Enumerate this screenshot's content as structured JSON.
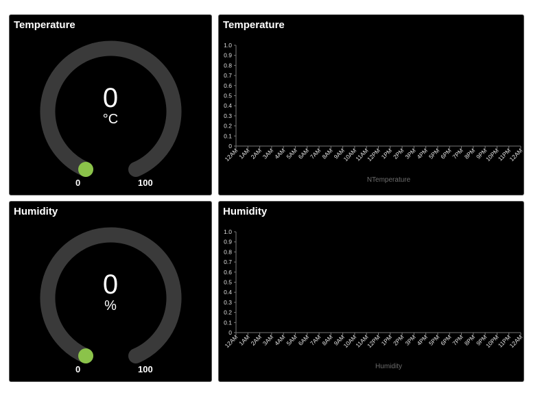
{
  "panels": {
    "temp_gauge": {
      "title": "Temperature",
      "value": "0",
      "unit": "°C",
      "min": "0",
      "max": "100",
      "track_color": "#3a3a3a",
      "indicator_color": "#8bc34a"
    },
    "temp_chart": {
      "title": "Temperature"
    },
    "hum_gauge": {
      "title": "Humidity",
      "value": "0",
      "unit": "%",
      "min": "0",
      "max": "100",
      "track_color": "#3a3a3a",
      "indicator_color": "#8bc34a"
    },
    "hum_chart": {
      "title": "Humidity"
    }
  },
  "chart_data": [
    {
      "type": "line",
      "title": "",
      "xlabel": "NTemperature",
      "ylabel": "",
      "x": [
        "12AM",
        "1AM",
        "2AM",
        "3AM",
        "4AM",
        "5AM",
        "6AM",
        "7AM",
        "8AM",
        "9AM",
        "10AM",
        "11AM",
        "12PM",
        "1PM",
        "2PM",
        "3PM",
        "4PM",
        "5PM",
        "6PM",
        "7PM",
        "8PM",
        "9PM",
        "10PM",
        "11PM",
        "12AM"
      ],
      "yticks": [
        "0",
        "0.1",
        "0.2",
        "0.3",
        "0.4",
        "0.5",
        "0.6",
        "0.7",
        "0.8",
        "0.9",
        "1.0"
      ],
      "ylim": [
        0,
        1.0
      ],
      "series": [],
      "grid": false
    },
    {
      "type": "line",
      "title": "",
      "xlabel": "Humidity",
      "ylabel": "",
      "x": [
        "12AM",
        "1AM",
        "2AM",
        "3AM",
        "4AM",
        "5AM",
        "6AM",
        "7AM",
        "8AM",
        "9AM",
        "10AM",
        "11AM",
        "12PM",
        "1PM",
        "2PM",
        "3PM",
        "4PM",
        "5PM",
        "6PM",
        "7PM",
        "8PM",
        "9PM",
        "10PM",
        "11PM",
        "12AM"
      ],
      "yticks": [
        "0",
        "0.1",
        "0.2",
        "0.3",
        "0.4",
        "0.5",
        "0.6",
        "0.7",
        "0.8",
        "0.9",
        "1.0"
      ],
      "ylim": [
        0,
        1.0
      ],
      "series": [],
      "grid": false
    }
  ]
}
